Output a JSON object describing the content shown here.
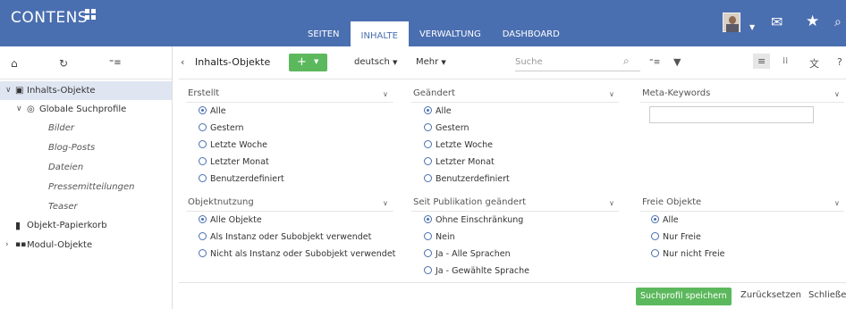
{
  "app": {
    "logo": "CONTENS"
  },
  "nav": {
    "tabs": [
      {
        "label": "SEITEN"
      },
      {
        "label": "INHALTE"
      },
      {
        "label": "VERWALTUNG"
      },
      {
        "label": "DASHBOARD"
      }
    ],
    "active": "INHALTE"
  },
  "sidebar": {
    "tree": [
      {
        "label": "Inhalts-Objekte"
      },
      {
        "label": "Globale Suchprofile"
      },
      {
        "label": "Bilder"
      },
      {
        "label": "Blog-Posts"
      },
      {
        "label": "Dateien"
      },
      {
        "label": "Pressemitteilungen"
      },
      {
        "label": "Teaser"
      },
      {
        "label": "Objekt-Papierkorb"
      },
      {
        "label": "Modul-Objekte"
      }
    ]
  },
  "toolbar": {
    "title": "Inhalts-Objekte",
    "add_label": "+",
    "language": "deutsch",
    "more": "Mehr",
    "search_placeholder": "Suche"
  },
  "filters": {
    "erstellt": {
      "title": "Erstellt",
      "options": [
        "Alle",
        "Gestern",
        "Letzte Woche",
        "Letzter Monat",
        "Benutzerdefiniert"
      ],
      "selected": "Alle"
    },
    "geaendert": {
      "title": "Geändert",
      "options": [
        "Alle",
        "Gestern",
        "Letzte Woche",
        "Letzter Monat",
        "Benutzerdefiniert"
      ],
      "selected": "Alle"
    },
    "meta": {
      "title": "Meta-Keywords",
      "value": ""
    },
    "objektnutzung": {
      "title": "Objektnutzung",
      "options": [
        "Alle Objekte",
        "Als Instanz oder Subobjekt verwendet",
        "Nicht als Instanz oder Subobjekt verwendet"
      ],
      "selected": "Alle Objekte"
    },
    "seit_publikation": {
      "title": "Seit Publikation geändert",
      "options": [
        "Ohne Einschränkung",
        "Nein",
        "Ja - Alle Sprachen",
        "Ja - Gewählte Sprache"
      ],
      "selected": "Ohne Einschränkung"
    },
    "freie": {
      "title": "Freie Objekte",
      "options": [
        "Alle",
        "Nur Freie",
        "Nur nicht Freie"
      ],
      "selected": "Alle"
    }
  },
  "actions": {
    "save": "Suchprofil speichern",
    "reset": "Zurücksetzen",
    "close": "Schließen"
  },
  "colors": {
    "brand": "#4a6fb0",
    "accent_green": "#5cb85c",
    "selection": "#dfe6f2"
  }
}
